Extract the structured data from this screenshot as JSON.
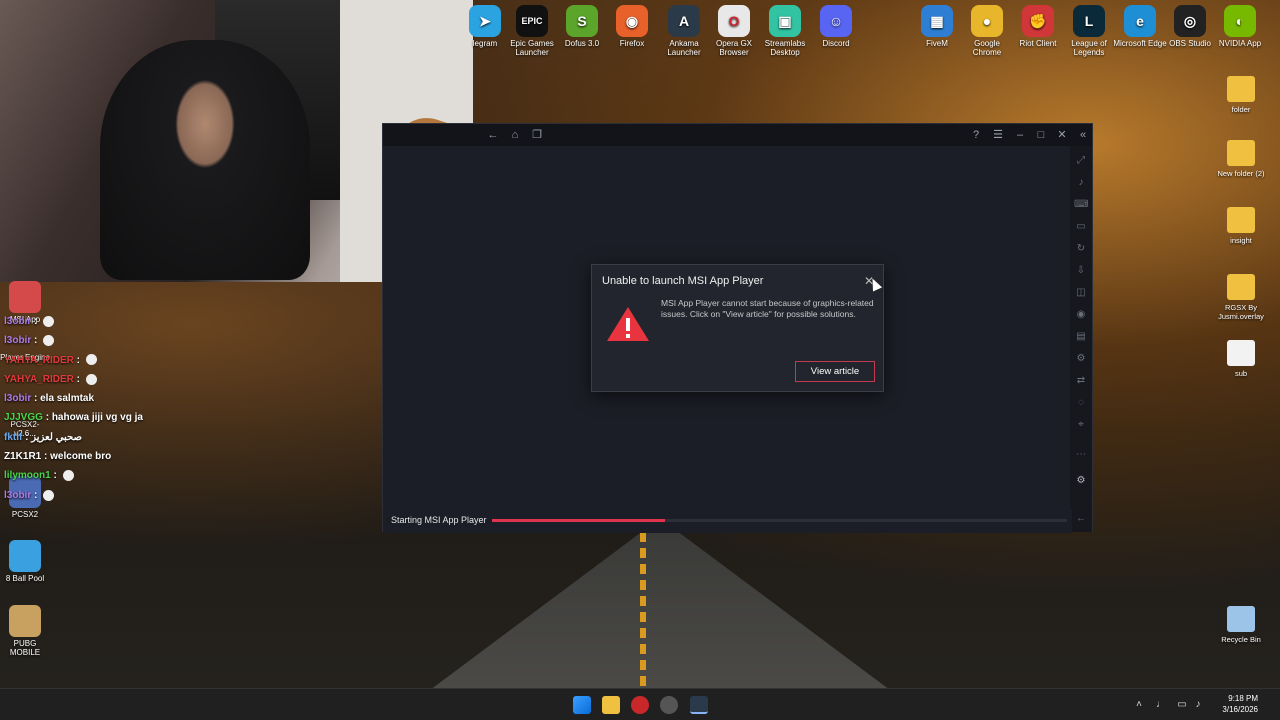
{
  "top_icons": [
    {
      "id": "telegram",
      "label": "legram",
      "color": "#2aa3e0",
      "glyph": "➤"
    },
    {
      "id": "epic",
      "label": "Epic Games Launcher",
      "color": "#111111",
      "glyph": "EPIC"
    },
    {
      "id": "dofus",
      "label": "Dofus 3.0",
      "color": "#5aa52a",
      "glyph": "S"
    },
    {
      "id": "firefox",
      "label": "Firefox",
      "color": "#e8602a",
      "glyph": "◉"
    },
    {
      "id": "ankama",
      "label": "Ankama Launcher",
      "color": "#2a3a48",
      "glyph": "A"
    },
    {
      "id": "opera",
      "label": "Opera GX Browser",
      "color": "#e8e8e8",
      "glyph": "O"
    },
    {
      "id": "streamlabs",
      "label": "Streamlabs Desktop",
      "color": "#31c3a2",
      "glyph": "▣"
    },
    {
      "id": "discord",
      "label": "Discord",
      "color": "#5865f2",
      "glyph": "☺"
    },
    {
      "id": "fivem",
      "label": "FiveM",
      "color": "#2e7fd4",
      "glyph": "▦"
    },
    {
      "id": "chrome",
      "label": "Google Chrome",
      "color": "#e8b62a",
      "glyph": "●"
    },
    {
      "id": "riot",
      "label": "Riot Client",
      "color": "#d13639",
      "glyph": "✊"
    },
    {
      "id": "lol",
      "label": "League of Legends",
      "color": "#0a2a3a",
      "glyph": "L"
    },
    {
      "id": "edge",
      "label": "Microsoft Edge",
      "color": "#1e8fd4",
      "glyph": "e"
    },
    {
      "id": "obs",
      "label": "OBS Studio",
      "color": "#222222",
      "glyph": "◎"
    },
    {
      "id": "nvidia",
      "label": "NVIDIA App",
      "color": "#76b900",
      "glyph": "◐"
    }
  ],
  "right_icons": [
    {
      "id": "folder",
      "label": "folder",
      "color": "#f0c040"
    },
    {
      "id": "new-folder",
      "label": "New folder (2)",
      "color": "#f0c040"
    },
    {
      "id": "insight",
      "label": "insight",
      "color": "#f0c040"
    },
    {
      "id": "rgsx",
      "label": "RGSX By Jusmi.overlay",
      "color": "#f0c040"
    },
    {
      "id": "sub",
      "label": "sub",
      "color": "#f2f2f2"
    },
    {
      "id": "recycle",
      "label": "Recycle Bin",
      "color": "#9cc4e8"
    }
  ],
  "left_icons": [
    {
      "id": "msi-app",
      "label": "MSI App"
    },
    {
      "id": "player-engine",
      "label": "Player Engine"
    },
    {
      "id": "pcsx2-v",
      "label": "PCSX2-v2.6..."
    },
    {
      "id": "pcsx2",
      "label": "PCSX2"
    },
    {
      "id": "8ball",
      "label": "8 Ball Pool"
    },
    {
      "id": "pubg",
      "label": "PUBG MOBILE"
    }
  ],
  "chat": [
    {
      "user": "l3obir",
      "color": "#b07ae8",
      "msg": ""
    },
    {
      "user": "l3obir",
      "color": "#b07ae8",
      "msg": ""
    },
    {
      "user": "YAHYA_RIDER",
      "color": "#e03a3a",
      "msg": ""
    },
    {
      "user": "YAHYA_RIDER",
      "color": "#e03a3a",
      "msg": ""
    },
    {
      "user": "l3obir",
      "color": "#b07ae8",
      "msg": "ela salmtak"
    },
    {
      "user": "JJJVGG",
      "color": "#4ad44a",
      "msg": "hahowa jiji vg vg ja"
    },
    {
      "user": "fktlf",
      "color": "#6aaaf0",
      "msg": "صحبي لعزيز"
    },
    {
      "user": "Z1K1R1",
      "color": "#ffffff",
      "msg": "welcome bro"
    },
    {
      "user": "lilymoon1",
      "color": "#4ad44a",
      "msg": ""
    },
    {
      "user": "l3obir",
      "color": "#b07ae8",
      "msg": ""
    }
  ],
  "player": {
    "footer_label": "Starting MSI App Player",
    "progress": 0.3
  },
  "dialog": {
    "title": "Unable to launch MSI App Player",
    "message": "MSI App Player cannot start because of graphics-related issues. Click on \"View article\" for possible solutions.",
    "button": "View article",
    "close_glyph": "✕"
  },
  "taskbar": {
    "time": "9:18 PM",
    "date": "3/16/2026"
  },
  "colors": {
    "accent": "#e0334d",
    "dialog_bg": "#22252d",
    "player_bg": "#1b1e26"
  }
}
